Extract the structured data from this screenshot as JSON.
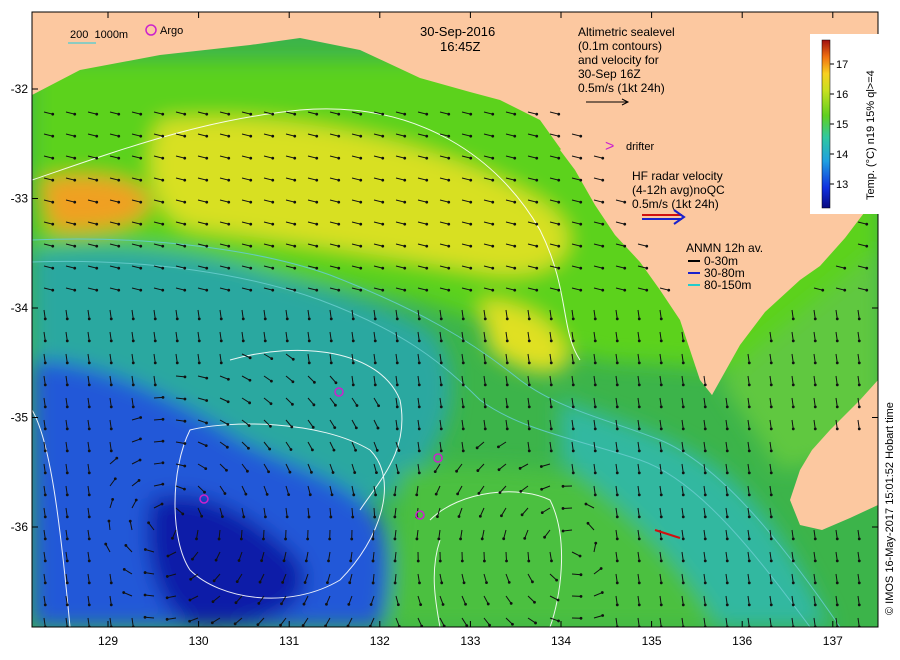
{
  "title": {
    "date": "30-Sep-2016",
    "time": "16:45Z"
  },
  "scale_legend": {
    "label": "200  1000m",
    "color": "#66cccc"
  },
  "argo": {
    "label": "Argo",
    "color": "#cc22cc"
  },
  "altimetry": {
    "line1": "Altimetric sealevel",
    "line2": "(0.1m contours)",
    "line3": "and velocity for",
    "line4": "30-Sep 16Z",
    "line5": "0.5m/s (1kt 24h)"
  },
  "drifter": {
    "label": "drifter",
    "color": "#cc22cc"
  },
  "hf_radar": {
    "line1": "HF radar velocity",
    "line2": "(4-12h avg)noQC",
    "line3": "0.5m/s (1kt 24h)"
  },
  "anmn": {
    "title": "ANMN 12h av.",
    "items": [
      {
        "label": "0-30m",
        "color": "#000000"
      },
      {
        "label": "30-80m",
        "color": "#1a22cc"
      },
      {
        "label": "80-150m",
        "color": "#22cccc"
      }
    ]
  },
  "colorbar": {
    "label": "Temp. (°C) n19 15% ql>=4",
    "ticks": [
      "17",
      "16",
      "15",
      "14",
      "13"
    ],
    "min": 12.2,
    "max": 17.8
  },
  "x_axis": {
    "ticks": [
      "129",
      "130",
      "131",
      "132",
      "133",
      "134",
      "135",
      "136",
      "137"
    ]
  },
  "y_axis": {
    "ticks": [
      "-32",
      "-33",
      "-34",
      "-35",
      "-36"
    ]
  },
  "credit": "© IMOS 16-May-2017 15:01:52 Hobart time",
  "colors": {
    "land": "#fcc8a0",
    "warm": "#f5e020",
    "mid": "#5cd21e",
    "cool": "#2aa4b2",
    "cold": "#2058d8",
    "coldest": "#0a1ea8"
  }
}
